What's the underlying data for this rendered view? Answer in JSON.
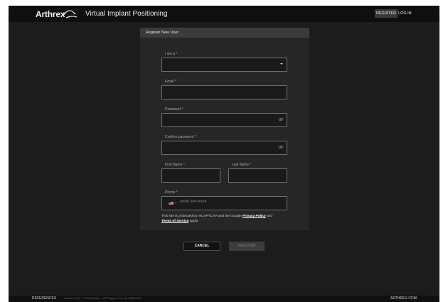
{
  "header": {
    "brand_name": "Arthrex",
    "product_name": "Virtual Implant Positioning",
    "nav": {
      "register": "REGISTER",
      "login": "LOG IN"
    }
  },
  "form": {
    "title": "Register New User",
    "role": {
      "label": "I am a *",
      "value": ""
    },
    "email": {
      "label": "Email *",
      "value": ""
    },
    "password": {
      "label": "Password *",
      "value": ""
    },
    "confirm_password": {
      "label": "Confirm password *",
      "value": ""
    },
    "first_name": {
      "label": "First Name *",
      "value": ""
    },
    "last_name": {
      "label": "Last Name *",
      "value": ""
    },
    "phone": {
      "label": "Phone *",
      "placeholder": "(###) ###-####",
      "country": "us-flag-icon"
    },
    "recaptcha": {
      "text_before": "This site is protected by reCAPTCHA and the Google ",
      "privacy_link": "Privacy Policy",
      "text_middle": " and ",
      "terms_link": "Terms of Service",
      "text_after": " apply."
    }
  },
  "actions": {
    "cancel": "CANCEL",
    "register": "REGISTER"
  },
  "footer": {
    "references": "REFERENCES",
    "info": "Version 8.0.0  ·  © 2024 Arthrex  ·  VIP Support Line: 801-555-0134",
    "site": "ARTHREX.COM"
  },
  "colors": {
    "page_bg": "#1c1c1c",
    "bar_bg": "#0f0f0f",
    "panel_bg": "#262626",
    "panel_header_bg": "#3b3b3b",
    "field_border": "#707070",
    "disabled_button": "#3c3c3c"
  }
}
